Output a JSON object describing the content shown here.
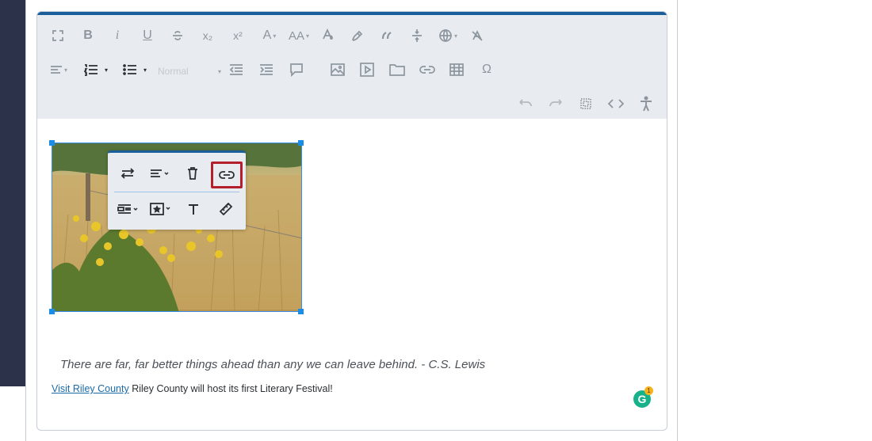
{
  "toolbar": {
    "row1": [
      "fullscreen-icon",
      "bold-icon",
      "italic-icon",
      "underline-icon",
      "strikethrough-icon",
      "subscript-icon",
      "superscript-icon",
      "font-color-icon",
      "font-size-icon",
      "text-color-drop-icon",
      "highlight-icon",
      "blockquote-icon",
      "horizontal-rule-icon",
      "language-icon",
      "clear-format-icon"
    ],
    "bold_label": "B",
    "italic_label": "i",
    "underline_label": "U",
    "subscript_label": "x₂",
    "superscript_label": "x²",
    "font_color_label": "A",
    "font_size_label": "AA",
    "format_select_value": "Normal",
    "row2": [
      "align-icon",
      "ordered-list-icon",
      "unordered-list-icon",
      "format-select",
      "outdent-icon",
      "indent-icon",
      "comment-icon",
      "image-icon",
      "video-icon",
      "file-icon",
      "link-icon",
      "table-icon",
      "special-char-icon"
    ],
    "special_char_label": "Ω",
    "row3": [
      "undo-icon",
      "redo-icon",
      "select-all-icon",
      "code-view-icon",
      "accessibility-icon"
    ]
  },
  "image_toolbar": {
    "row1": [
      "replace-icon",
      "align-icon",
      "delete-icon",
      "link-icon"
    ],
    "row2": [
      "display-icon",
      "style-icon",
      "alt-text-icon",
      "size-icon"
    ],
    "highlighted": "link-icon"
  },
  "content": {
    "quote": "There are far, far better things ahead than any we can leave behind. - C.S. Lewis",
    "link_text": "Visit Riley County",
    "body_text": " Riley County will host its first Literary Festival!"
  },
  "grammarly": {
    "letter": "G",
    "count": "1",
    "color": "#17b28a"
  },
  "colors": {
    "accent": "#1b5e9c",
    "highlight": "#b41f2e",
    "sidebar": "#2c3249"
  }
}
